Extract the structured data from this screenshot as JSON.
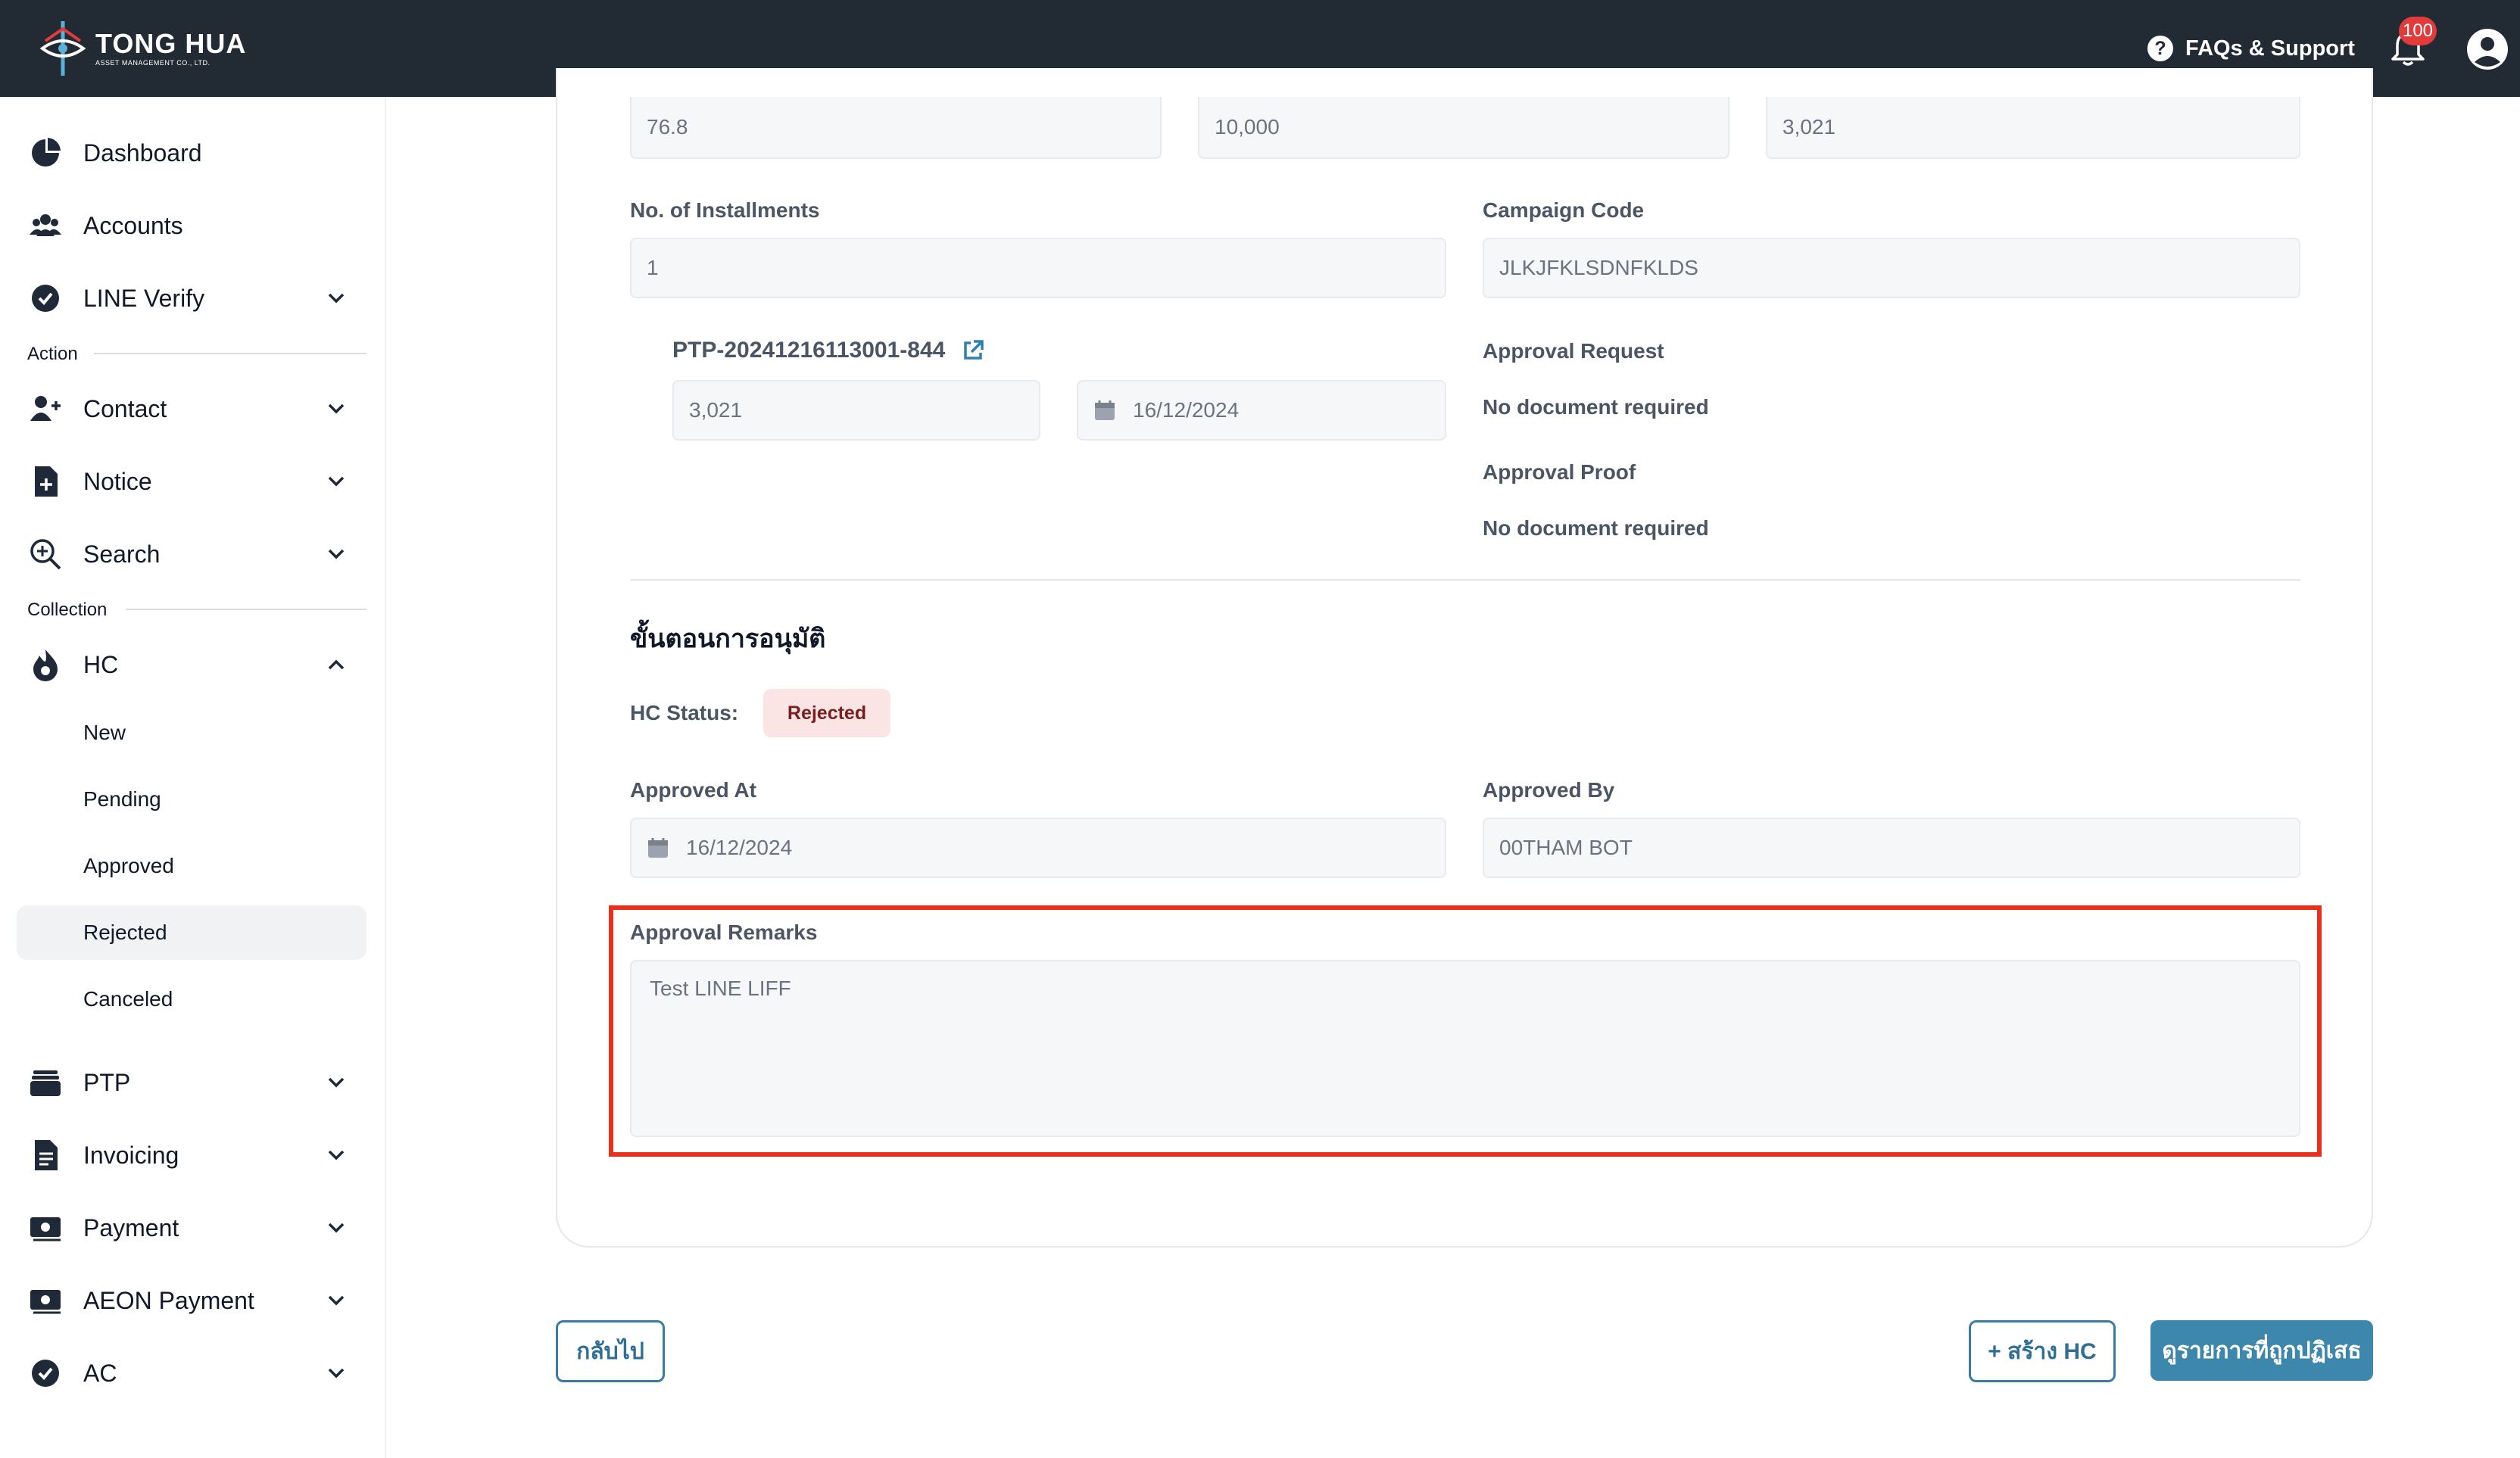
{
  "header": {
    "brand": "TONG HUA",
    "brand_sub": "ASSET MANAGEMENT CO., LTD.",
    "faq_label": "FAQs & Support",
    "notification_count": "100"
  },
  "sidebar": {
    "items": [
      {
        "label": "Dashboard"
      },
      {
        "label": "Accounts"
      },
      {
        "label": "LINE Verify"
      }
    ],
    "section_action": "Action",
    "action_items": [
      {
        "label": "Contact"
      },
      {
        "label": "Notice"
      },
      {
        "label": "Search"
      }
    ],
    "section_collection": "Collection",
    "hc": {
      "label": "HC",
      "children": [
        "New",
        "Pending",
        "Approved",
        "Rejected",
        "Canceled"
      ],
      "active": "Rejected"
    },
    "bottom_items": [
      {
        "label": "PTP"
      },
      {
        "label": "Invoicing"
      },
      {
        "label": "Payment"
      },
      {
        "label": "AEON Payment"
      },
      {
        "label": "AC"
      }
    ]
  },
  "form": {
    "top_values": [
      "76.8",
      "10,000",
      "3,021"
    ],
    "installments_label": "No. of Installments",
    "installments_value": "1",
    "campaign_label": "Campaign Code",
    "campaign_value": "JLKJFKLSDNFKLDS",
    "ptp_id": "PTP-20241216113001-844",
    "ptp_amount": "3,021",
    "ptp_date": "16/12/2024",
    "approval_request_label": "Approval Request",
    "approval_request_value": "No document required",
    "approval_proof_label": "Approval Proof",
    "approval_proof_value": "No document required",
    "section_heading": "ขั้นตอนการอนุมัติ",
    "hc_status_label": "HC Status:",
    "hc_status_value": "Rejected",
    "approved_at_label": "Approved At",
    "approved_at_value": "16/12/2024",
    "approved_by_label": "Approved By",
    "approved_by_value": "00THAM BOT",
    "remarks_label": "Approval Remarks",
    "remarks_value": "Test LINE LIFF"
  },
  "actions": {
    "back_label": "กลับไป",
    "create_hc_label": "+ สร้าง HC",
    "view_rejected_label": "ดูรายการที่ถูกปฏิเสธ"
  },
  "colors": {
    "topbar": "#222a33",
    "accent": "#3d87ad",
    "highlight": "#e8301d",
    "rejected_bg": "#fbe4e4"
  }
}
